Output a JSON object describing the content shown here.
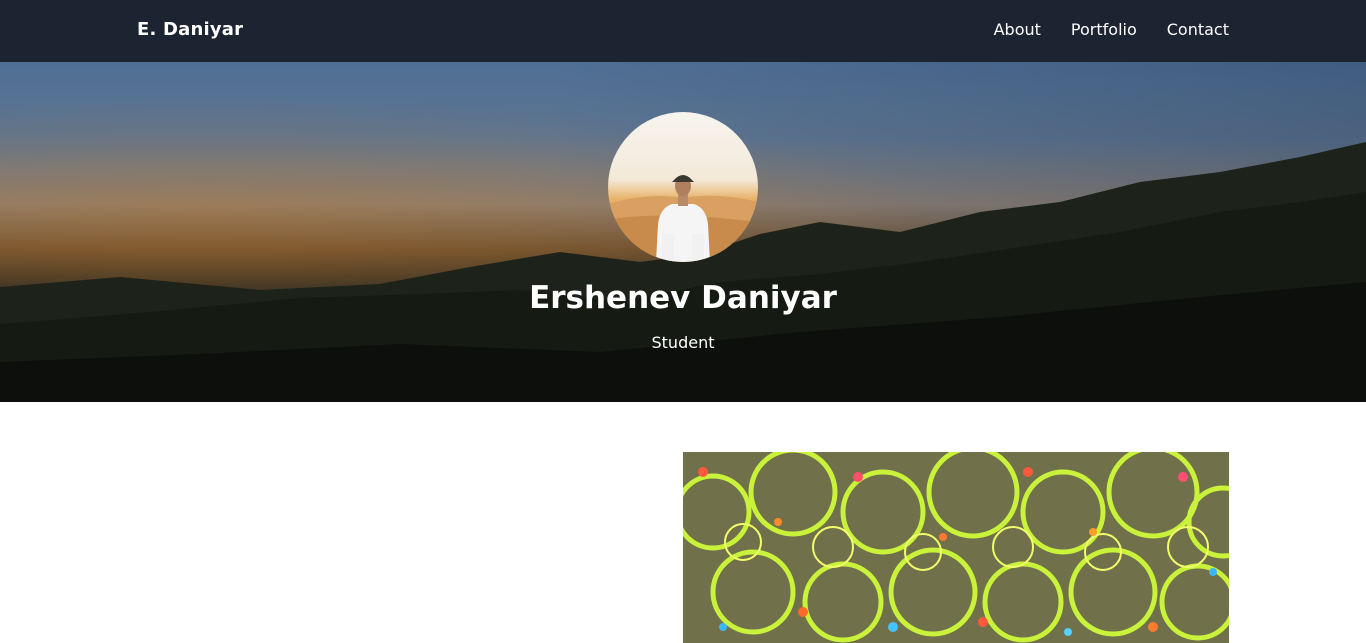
{
  "navbar": {
    "brand": "E. Daniyar",
    "links": [
      {
        "label": "About"
      },
      {
        "label": "Portfolio"
      },
      {
        "label": "Contact"
      }
    ],
    "background": "#1c2331"
  },
  "hero": {
    "name": "Ershenev Daniyar",
    "role": "Student"
  },
  "images": {
    "avatar": "profile-photo",
    "artwork": "kaleidoscope-painting"
  }
}
